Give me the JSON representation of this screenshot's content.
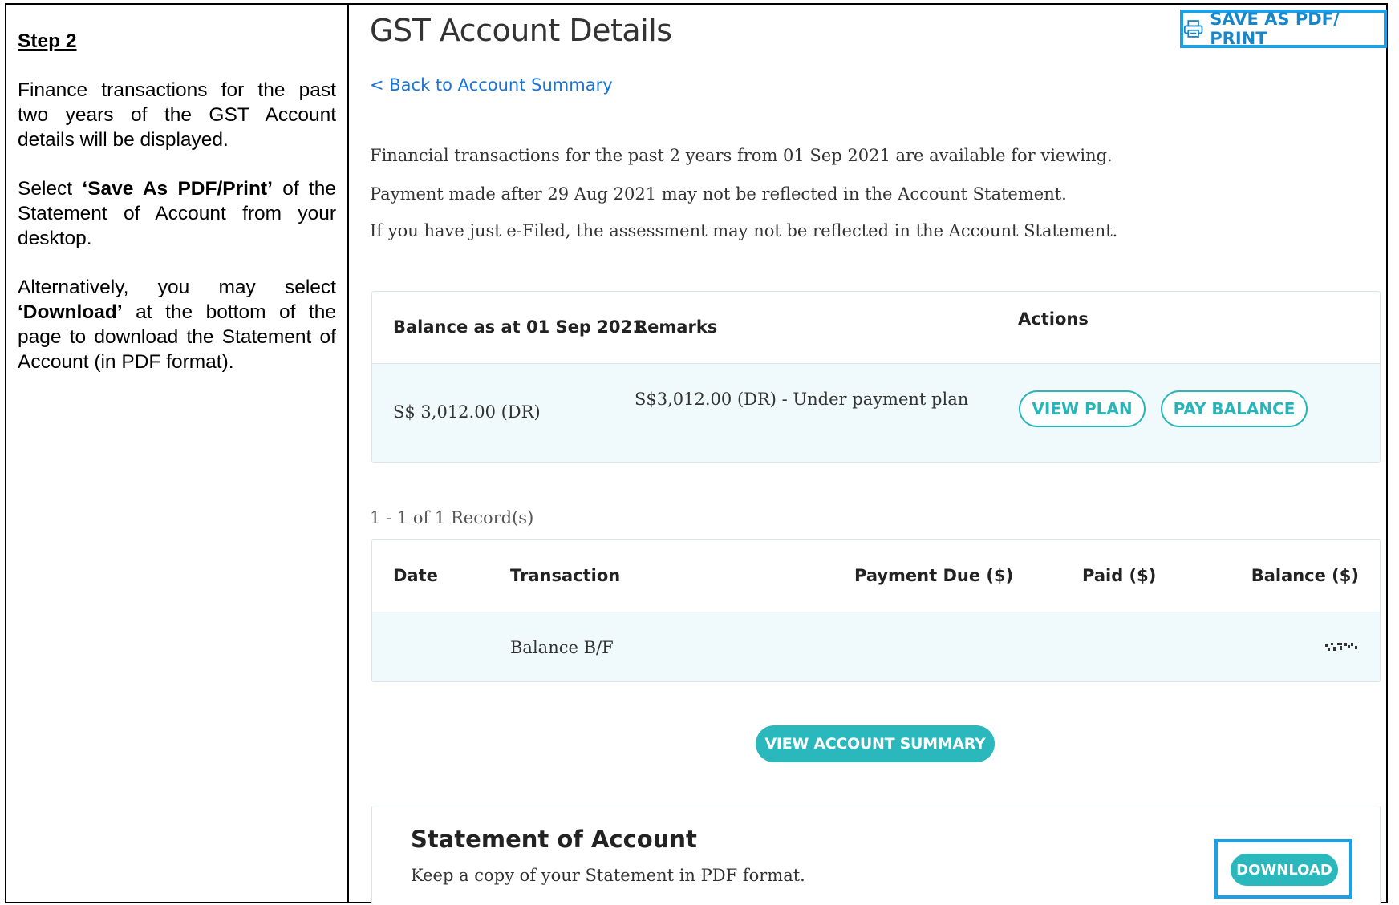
{
  "instructions": {
    "step": "Step 2",
    "para1": "Finance transactions for the past two years of the GST Account details will be displayed.",
    "para2_pre": "Select ",
    "para2_bold": "‘Save As PDF/Print’",
    "para2_post": " of the Statement of Account from your desktop.",
    "para3_pre": "Alternatively, you may select ",
    "para3_bold": "‘Download’",
    "para3_post": " at the bottom of the page to download the Statement of Account (in PDF format)."
  },
  "header": {
    "title": "GST Account Details",
    "save_pdf_label": "SAVE AS PDF/ PRINT",
    "back_link": "< Back to Account Summary"
  },
  "info": {
    "line1": "Financial transactions for the past 2 years from 01 Sep 2021 are available for viewing.",
    "line2": "Payment made after 29 Aug 2021 may not be reflected in the Account Statement.",
    "line3": "If you have just e-Filed, the assessment may not be reflected in the Account Statement."
  },
  "balance_table": {
    "col_balance": "Balance as at 01 Sep 2021",
    "col_remarks": "Remarks",
    "col_actions": "Actions",
    "balance_value": "S$ 3,012.00 (DR)",
    "remarks_value": "S$3,012.00 (DR) - Under payment plan",
    "view_plan": "VIEW PLAN",
    "pay_balance": "PAY BALANCE"
  },
  "records_text": "1 - 1 of 1 Record(s)",
  "transactions": {
    "headers": {
      "date": "Date",
      "transaction": "Transaction",
      "payment_due": "Payment Due ($)",
      "paid": "Paid ($)",
      "balance": "Balance ($)"
    },
    "rows": [
      {
        "date": "",
        "transaction": "Balance B/F",
        "payment_due": "",
        "paid": "",
        "balance": ""
      }
    ]
  },
  "view_account_summary": "VIEW ACCOUNT SUMMARY",
  "statement": {
    "title": "Statement of Account",
    "subtitle": "Keep a copy of your Statement in PDF format.",
    "download": "DOWNLOAD"
  },
  "colors": {
    "highlight_frame": "#1da1e6",
    "teal_button": "#2ab8bd",
    "link_blue": "#1a73d9"
  }
}
